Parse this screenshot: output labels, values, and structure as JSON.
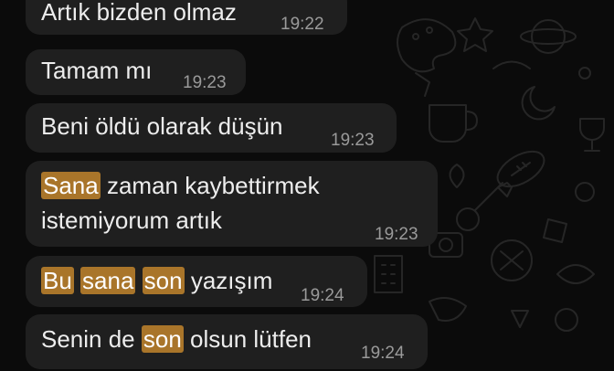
{
  "chat": {
    "messages": [
      {
        "parts": [
          {
            "text": "Artık bizden olmaz",
            "highlight": false
          }
        ],
        "time": "19:22"
      },
      {
        "parts": [
          {
            "text": "Tamam mı",
            "highlight": false
          }
        ],
        "time": "19:23"
      },
      {
        "parts": [
          {
            "text": "Beni öldü olarak düşün",
            "highlight": false
          }
        ],
        "time": "19:23"
      },
      {
        "line1": [
          {
            "text": "Sana",
            "highlight": true
          },
          {
            "text": " zaman kaybettirmek",
            "highlight": false
          }
        ],
        "line2": [
          {
            "text": "istemiyorum artık",
            "highlight": false
          }
        ],
        "time": "19:23"
      },
      {
        "parts": [
          {
            "text": "Bu",
            "highlight": true
          },
          {
            "text": " ",
            "highlight": false
          },
          {
            "text": "sana",
            "highlight": true
          },
          {
            "text": " ",
            "highlight": false
          },
          {
            "text": "son",
            "highlight": true
          },
          {
            "text": "  yazışım",
            "highlight": false
          }
        ],
        "time": "19:24"
      },
      {
        "parts": [
          {
            "text": "Senin de ",
            "highlight": false
          },
          {
            "text": "son",
            "highlight": true
          },
          {
            "text": " olsun lütfen",
            "highlight": false
          }
        ],
        "time": "19:24"
      }
    ]
  },
  "colors": {
    "background": "#0b0b0b",
    "bubble": "#1f1f1f",
    "text": "#ededed",
    "time": "#9a9a9a",
    "search_highlight": "#a9752a"
  },
  "wallpaper_icons": [
    "paint-palette-icon",
    "guitar-icon",
    "football-icon",
    "camera-icon",
    "trophy-icon",
    "building-icon",
    "star-icon",
    "moon-icon",
    "coffee-cup-icon",
    "planet-icon"
  ]
}
